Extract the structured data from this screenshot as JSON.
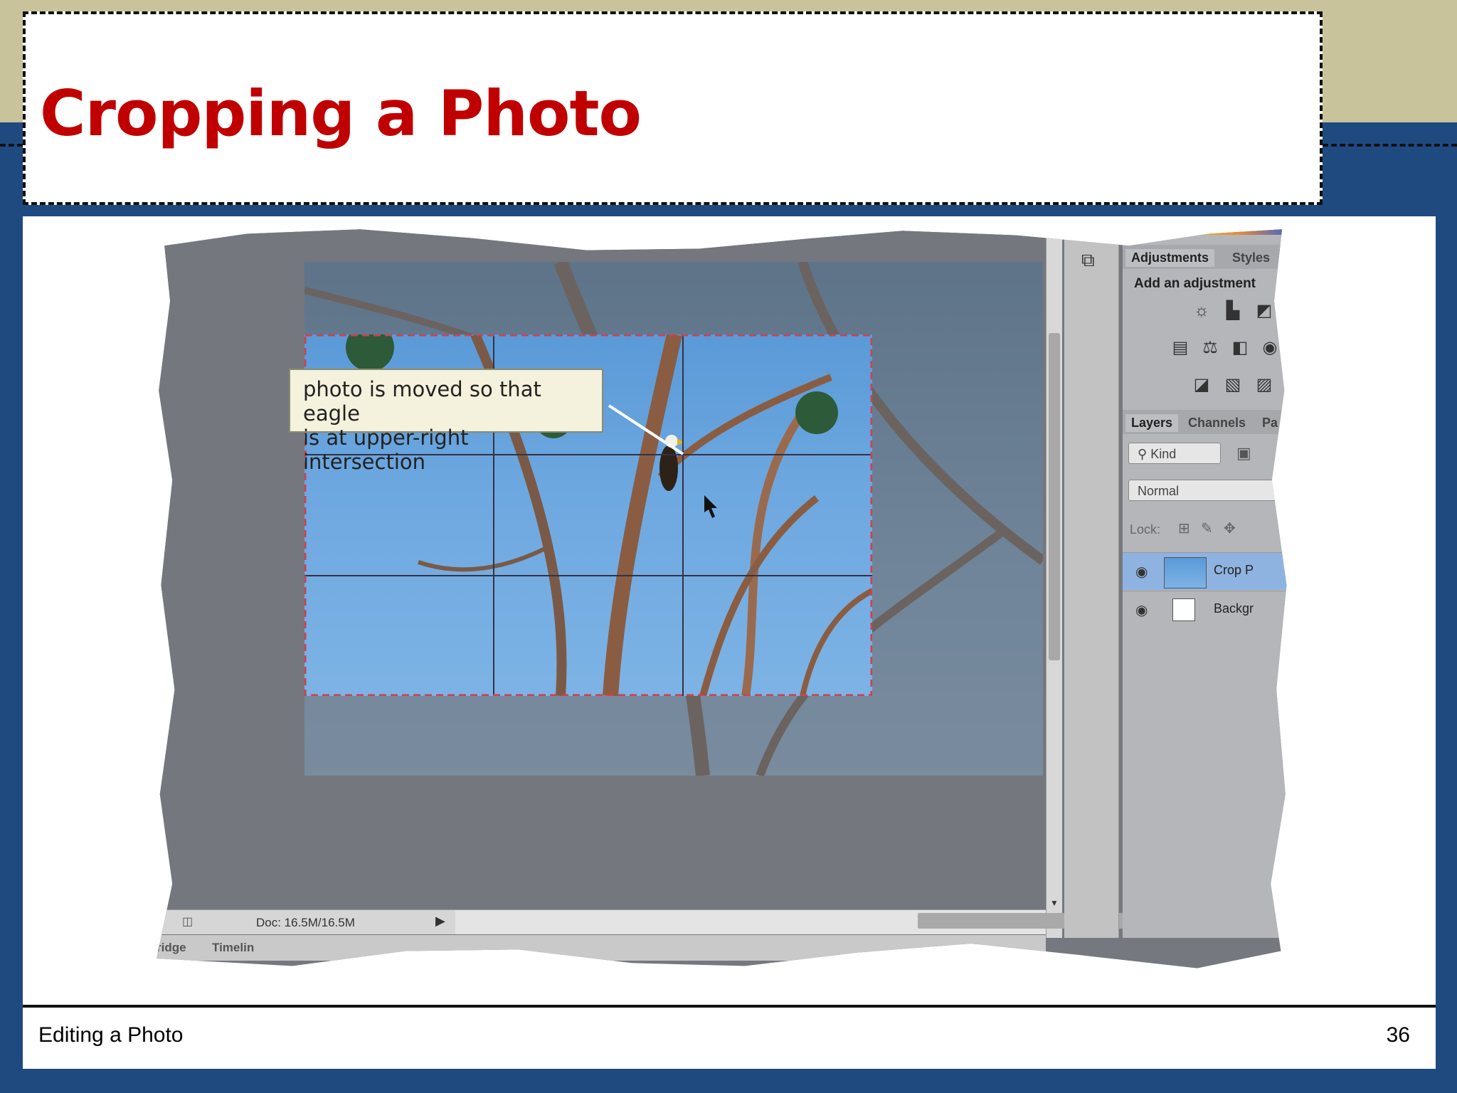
{
  "slide": {
    "title": "Cropping a Photo",
    "footer_left": "Editing a Photo",
    "page_number": "36"
  },
  "callout": {
    "line1": "photo is moved so that eagle",
    "line2": "is at upper-right intersection"
  },
  "app": {
    "status_doc": "Doc: 16.5M/16.5M",
    "bottom_tabs": [
      "ridge",
      "Timelin"
    ],
    "adjustments_tabs": [
      "Adjustments",
      "Styles"
    ],
    "adjustments_heading": "Add an adjustment",
    "layers_tabs": [
      "Layers",
      "Channels",
      "Pa"
    ],
    "kind_filter": "Kind",
    "blend_mode": "Normal",
    "lock_label": "Lock:",
    "layers": [
      {
        "name": "Crop P",
        "selected": true
      },
      {
        "name": "Backgr",
        "selected": false
      }
    ]
  },
  "colors": {
    "title_red": "#c00000",
    "navy": "#1f4a80",
    "khaki": "#c8c39a"
  }
}
